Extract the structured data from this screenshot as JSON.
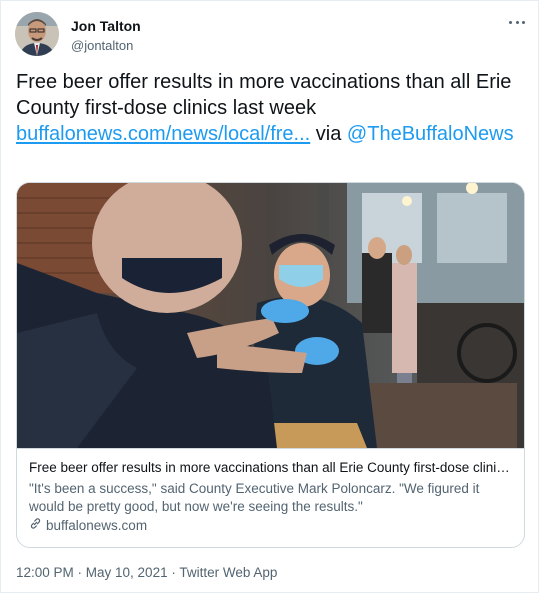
{
  "author": {
    "display_name": "Jon Talton",
    "handle": "@jontalton"
  },
  "tweet": {
    "text_line": "Free beer offer results in more vaccinations than all Erie County first-dose clinics last week",
    "link_text": "buffalonews.com/news/local/fre...",
    "via_text": "via",
    "mention": "@TheBuffaloNews"
  },
  "card": {
    "title": "Free beer offer results in more vaccinations than all Erie County first-dose clinics...",
    "description": "\"It's been a success,\" said County Executive Mark Poloncarz. \"We figured it would be pretty good, but now we're seeing the results.\"",
    "domain": "buffalonews.com"
  },
  "meta": {
    "timestamp": "12:00 PM · May 10, 2021 · Twitter Web App"
  },
  "colors": {
    "link": "#1d9bf0",
    "text": "#0f1419",
    "secondary": "#536471",
    "border": "#cfd9de"
  }
}
